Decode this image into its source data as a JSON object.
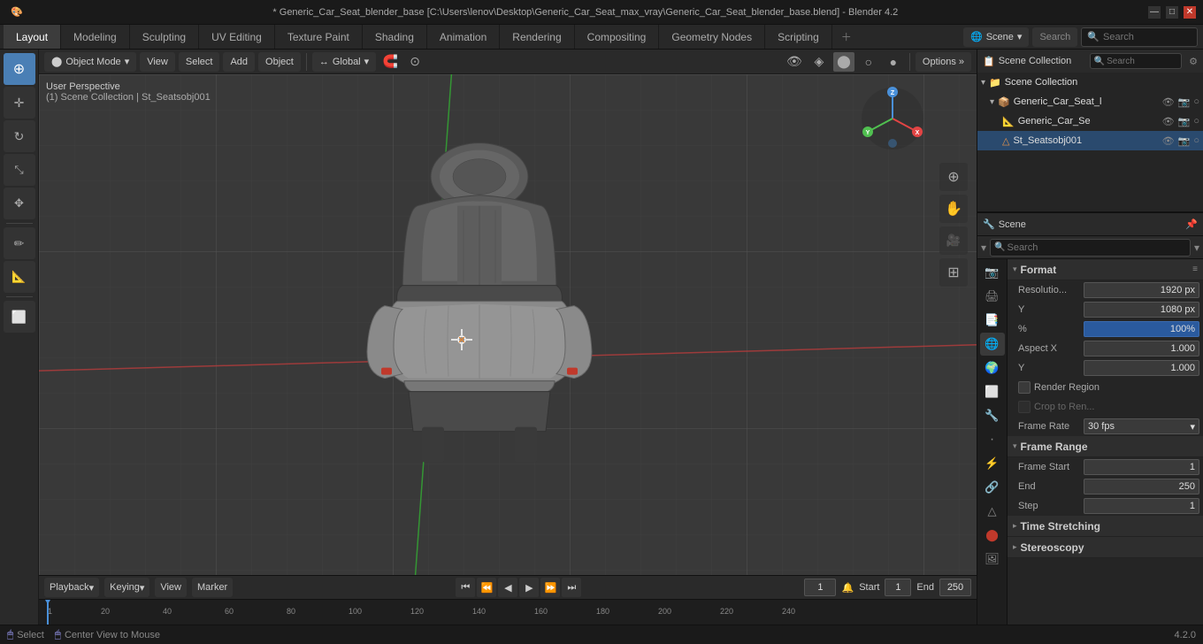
{
  "titlebar": {
    "text": "* Generic_Car_Seat_blender_base [C:\\Users\\lenov\\Desktop\\Generic_Car_Seat_max_vray\\Generic_Car_Seat_blender_base.blend] - Blender 4.2",
    "min": "—",
    "max": "□",
    "close": "✕"
  },
  "workspaceTabs": [
    {
      "id": "layout",
      "label": "Layout",
      "active": true
    },
    {
      "id": "modeling",
      "label": "Modeling"
    },
    {
      "id": "sculpting",
      "label": "Sculpting"
    },
    {
      "id": "uv-editing",
      "label": "UV Editing"
    },
    {
      "id": "texture-paint",
      "label": "Texture Paint"
    },
    {
      "id": "shading",
      "label": "Shading"
    },
    {
      "id": "animation",
      "label": "Animation"
    },
    {
      "id": "rendering",
      "label": "Rendering"
    },
    {
      "id": "compositing",
      "label": "Compositing"
    },
    {
      "id": "geometry-nodes",
      "label": "Geometry Nodes"
    },
    {
      "id": "scripting",
      "label": "Scripting"
    }
  ],
  "viewportHeader": {
    "objectMode": "Object Mode",
    "view": "View",
    "select": "Select",
    "add": "Add",
    "object": "Object",
    "global": "Global",
    "options": "Options »"
  },
  "viewport": {
    "perspectiveLabel": "User Perspective",
    "sceneInfo": "(1) Scene Collection | St_Seatsobj001"
  },
  "tools": [
    {
      "id": "cursor",
      "icon": "⊕",
      "active": true
    },
    {
      "id": "move",
      "icon": "↔"
    },
    {
      "id": "rotate",
      "icon": "↻"
    },
    {
      "id": "scale",
      "icon": "⤡"
    },
    {
      "id": "transform",
      "icon": "✥"
    },
    {
      "id": "annotate",
      "icon": "✏"
    },
    {
      "id": "measure",
      "icon": "📐"
    },
    {
      "id": "add-cube",
      "icon": "⬜"
    }
  ],
  "viewportWidgets": [
    {
      "id": "zoom-in",
      "icon": "⊕"
    },
    {
      "id": "pan",
      "icon": "✋"
    },
    {
      "id": "camera",
      "icon": "🎥"
    },
    {
      "id": "grid",
      "icon": "⊞"
    }
  ],
  "rightPanelSearch": "Search",
  "topSearchbar": "Search",
  "outliner": {
    "searchPlaceholder": "Search",
    "title": "Scene Collection",
    "items": [
      {
        "id": "scene-collection",
        "label": "Scene Collection",
        "icon": "📁",
        "level": 0,
        "expanded": true
      },
      {
        "id": "generic-car-seat-l",
        "label": "Generic_Car_Seat_l",
        "icon": "📦",
        "level": 1,
        "expanded": true
      },
      {
        "id": "generic-car-se",
        "label": "Generic_Car_Se",
        "icon": "📐",
        "level": 2
      },
      {
        "id": "st-seatsobj001",
        "label": "St_Seatsobj001",
        "icon": "△",
        "level": 2,
        "selected": true
      }
    ]
  },
  "propertiesPanel": {
    "title": "Scene",
    "searchPlaceholder": "Search",
    "activeSection": "scene-properties",
    "sections": [
      {
        "id": "format",
        "label": "Format",
        "expanded": true,
        "fields": [
          {
            "label": "Resolutio...",
            "value": "1920 px",
            "type": "number"
          },
          {
            "label": "Y",
            "value": "1080 px",
            "type": "number"
          },
          {
            "label": "%",
            "value": "100%",
            "type": "number-blue"
          },
          {
            "label": "Aspect X",
            "value": "1.000",
            "type": "number"
          },
          {
            "label": "Y",
            "value": "1.000",
            "type": "number"
          },
          {
            "label": "Render Region",
            "value": "",
            "type": "checkbox"
          },
          {
            "label": "Crop to Ren...",
            "value": "",
            "type": "disabled"
          },
          {
            "label": "Frame Rate",
            "value": "30 fps",
            "type": "dropdown"
          }
        ]
      },
      {
        "id": "frame-range",
        "label": "Frame Range",
        "expanded": true,
        "fields": [
          {
            "label": "Frame Start",
            "value": "1",
            "type": "number"
          },
          {
            "label": "End",
            "value": "250",
            "type": "number"
          },
          {
            "label": "Step",
            "value": "1",
            "type": "number"
          }
        ]
      },
      {
        "id": "time-stretching",
        "label": "Time Stretching",
        "expanded": false,
        "fields": []
      },
      {
        "id": "stereoscopy",
        "label": "Stereoscopy",
        "expanded": false,
        "fields": []
      }
    ]
  },
  "propsIcons": [
    {
      "id": "render",
      "icon": "📷",
      "title": "Render"
    },
    {
      "id": "output",
      "icon": "🖨",
      "title": "Output"
    },
    {
      "id": "view-layer",
      "icon": "📑",
      "title": "View Layer"
    },
    {
      "id": "scene",
      "icon": "🌐",
      "title": "Scene",
      "active": true
    },
    {
      "id": "world",
      "icon": "🌍",
      "title": "World"
    },
    {
      "id": "object",
      "icon": "⬜",
      "title": "Object"
    },
    {
      "id": "modifiers",
      "icon": "🔧",
      "title": "Modifiers"
    },
    {
      "id": "particles",
      "icon": "·",
      "title": "Particles"
    },
    {
      "id": "physics",
      "icon": "⚡",
      "title": "Physics"
    },
    {
      "id": "constraints",
      "icon": "🔗",
      "title": "Constraints"
    },
    {
      "id": "data",
      "icon": "△",
      "title": "Object Data"
    },
    {
      "id": "material",
      "icon": "⬤",
      "title": "Material"
    },
    {
      "id": "texture",
      "icon": "🖼",
      "title": "Texture"
    }
  ],
  "timeline": {
    "playback": "Playback",
    "keying": "Keying",
    "view": "View",
    "marker": "Marker",
    "frame": "1",
    "start": "Start",
    "startVal": "1",
    "end": "End",
    "endVal": "250",
    "rulerNumbers": [
      "1",
      "20",
      "40",
      "60",
      "80",
      "100",
      "120",
      "140",
      "160",
      "180",
      "200",
      "220",
      "240"
    ]
  },
  "statusBar": {
    "select": "Select",
    "centerView": "Center View to Mouse",
    "version": "4.2.0"
  },
  "gizmo": {
    "xLabel": "X",
    "yLabel": "Y",
    "zLabel": "Z"
  }
}
